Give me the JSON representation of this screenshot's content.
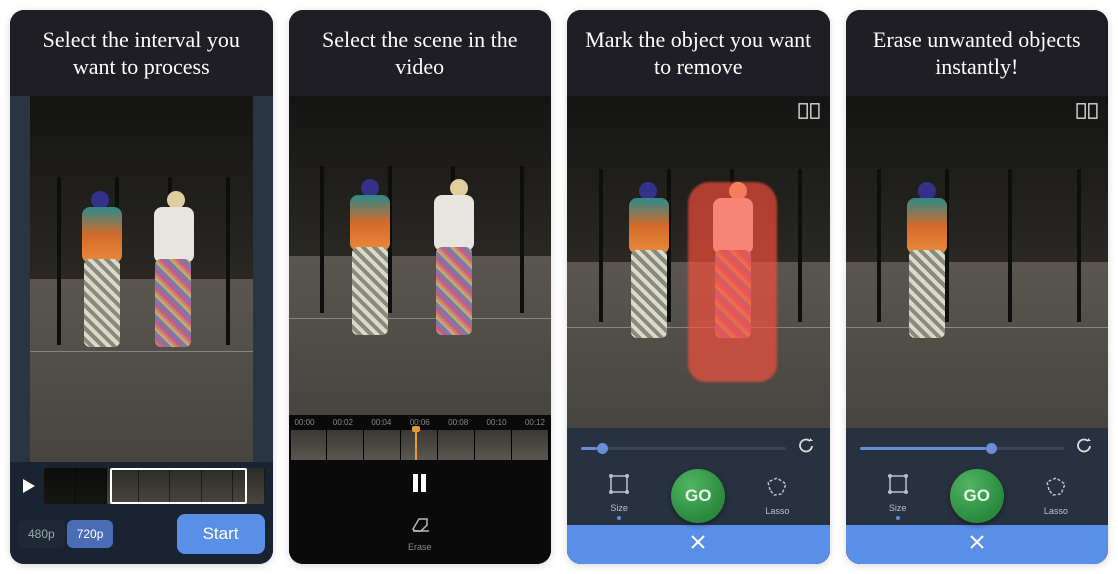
{
  "panels": [
    {
      "caption": "Select the interval you want to process",
      "resolution": {
        "options": [
          "480p",
          "720p"
        ],
        "active": "720p"
      },
      "start_label": "Start"
    },
    {
      "caption": "Select the scene in the video",
      "timeline": {
        "labels": [
          "00:00",
          "00:02",
          "00:04",
          "00:06",
          "00:08",
          "00:10",
          "00:12"
        ]
      },
      "erase_label": "Erase"
    },
    {
      "caption": "Mark the object you want to remove",
      "tools": {
        "size_label": "Size",
        "lasso_label": "Lasso",
        "go_label": "GO"
      },
      "scrub_pct": 8
    },
    {
      "caption": "Erase unwanted objects instantly!",
      "tools": {
        "size_label": "Size",
        "lasso_label": "Lasso",
        "go_label": "GO"
      },
      "scrub_pct": 62
    }
  ]
}
